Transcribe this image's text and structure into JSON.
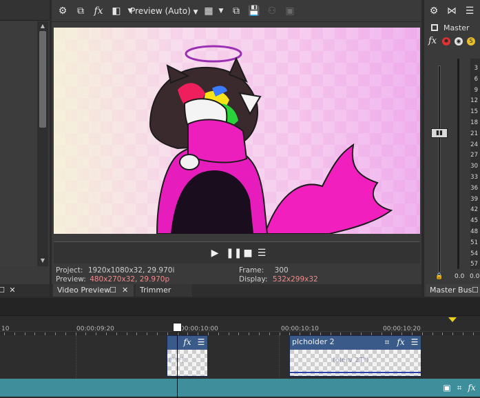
{
  "toolbar": {
    "preview_mode": "Preview (Auto)",
    "fx_label": "fx"
  },
  "preview_info": {
    "project_label": "Project:",
    "project_value": "1920x1080x32, 29.970i",
    "preview_label": "Preview:",
    "preview_value": "480x270x32, 29.970p",
    "frame_label": "Frame:",
    "frame_value": "300",
    "display_label": "Display:",
    "display_value": "532x299x32"
  },
  "preview_tabs": {
    "video_preview": "Video Preview",
    "trimmer": "Trimmer"
  },
  "mixer": {
    "master_label": "Master",
    "fx_label": "fx",
    "ticks": [
      "3",
      "6",
      "9",
      "12",
      "15",
      "18",
      "21",
      "24",
      "27",
      "30",
      "33",
      "36",
      "39",
      "42",
      "45",
      "48",
      "51",
      "54",
      "57"
    ],
    "bottom_left": "0.0",
    "bottom_right": "0.0",
    "tab_label": "Master Bus"
  },
  "timeline": {
    "ruler_labels": [
      "10",
      "00:00:09:20",
      "00:00:10:00",
      "00:00:10:10",
      "00:00:10:20"
    ],
    "clips": [
      {
        "name": "",
        "fx_label": "fx"
      },
      {
        "name": "plcholder 2",
        "fx_label": "fx"
      }
    ],
    "ghost_text": [
      "(ᵐᵒᵘ)",
      "(olerv 2Tʰ)"
    ]
  },
  "colors": {
    "accent_teal": "#3e8e9b",
    "clip_header": "#3a5a8a",
    "highlight_value": "#f08a8a",
    "marker_yellow": "#e8d21a"
  },
  "icons": [
    "gear-icon",
    "copy-icon",
    "fx-icon",
    "split-screen-icon",
    "chevron-down-icon",
    "grid-icon",
    "copy-to-clipboard-icon",
    "save-icon",
    "record-icon",
    "overlay-icon",
    "play-icon",
    "pause-icon",
    "stop-icon",
    "menu-icon",
    "close-icon",
    "window-icon",
    "crop-icon"
  ]
}
